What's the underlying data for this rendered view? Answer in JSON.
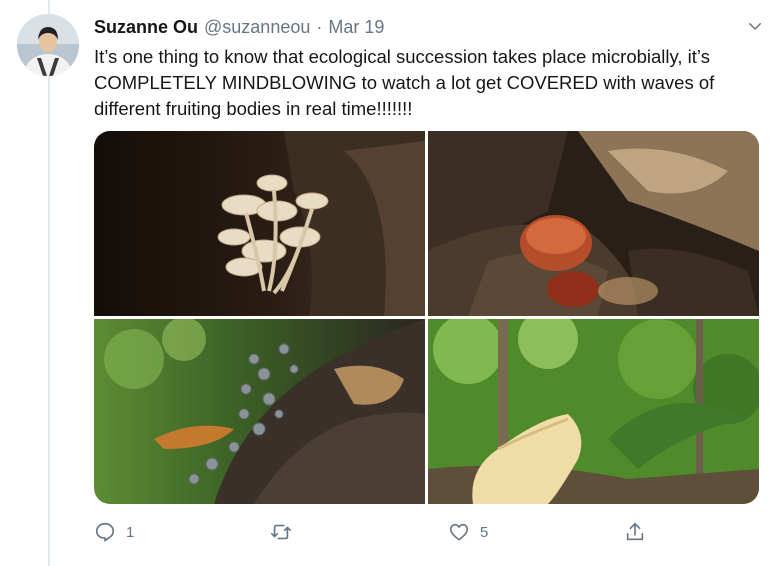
{
  "tweet": {
    "author_name": "Suzanne Ou",
    "handle": "@suzanneou",
    "separator": "·",
    "date": "Mar 19",
    "text": "It’s one thing to know that ecological succession takes place microbially, it’s COMPLETELY MINDBLOWING to watch a lot get COVERED with waves of different fruiting bodies in real time!!!!!!!",
    "media": [
      {
        "subject": "cluster of small pale mushrooms on dark bark"
      },
      {
        "subject": "red-brown shelf mushroom on log"
      },
      {
        "subject": "grey branching fungus on log with dry leaves"
      },
      {
        "subject": "pale ruffled mushroom in green forest"
      }
    ],
    "actions": {
      "reply_icon": "reply-icon",
      "reply_count": "1",
      "retweet_icon": "retweet-icon",
      "retweet_count": "",
      "like_icon": "heart-icon",
      "like_count": "5",
      "share_icon": "share-icon"
    }
  },
  "colors": {
    "text_primary": "#14171a",
    "text_secondary": "#657786",
    "thread_line": "#e1e8ed"
  }
}
